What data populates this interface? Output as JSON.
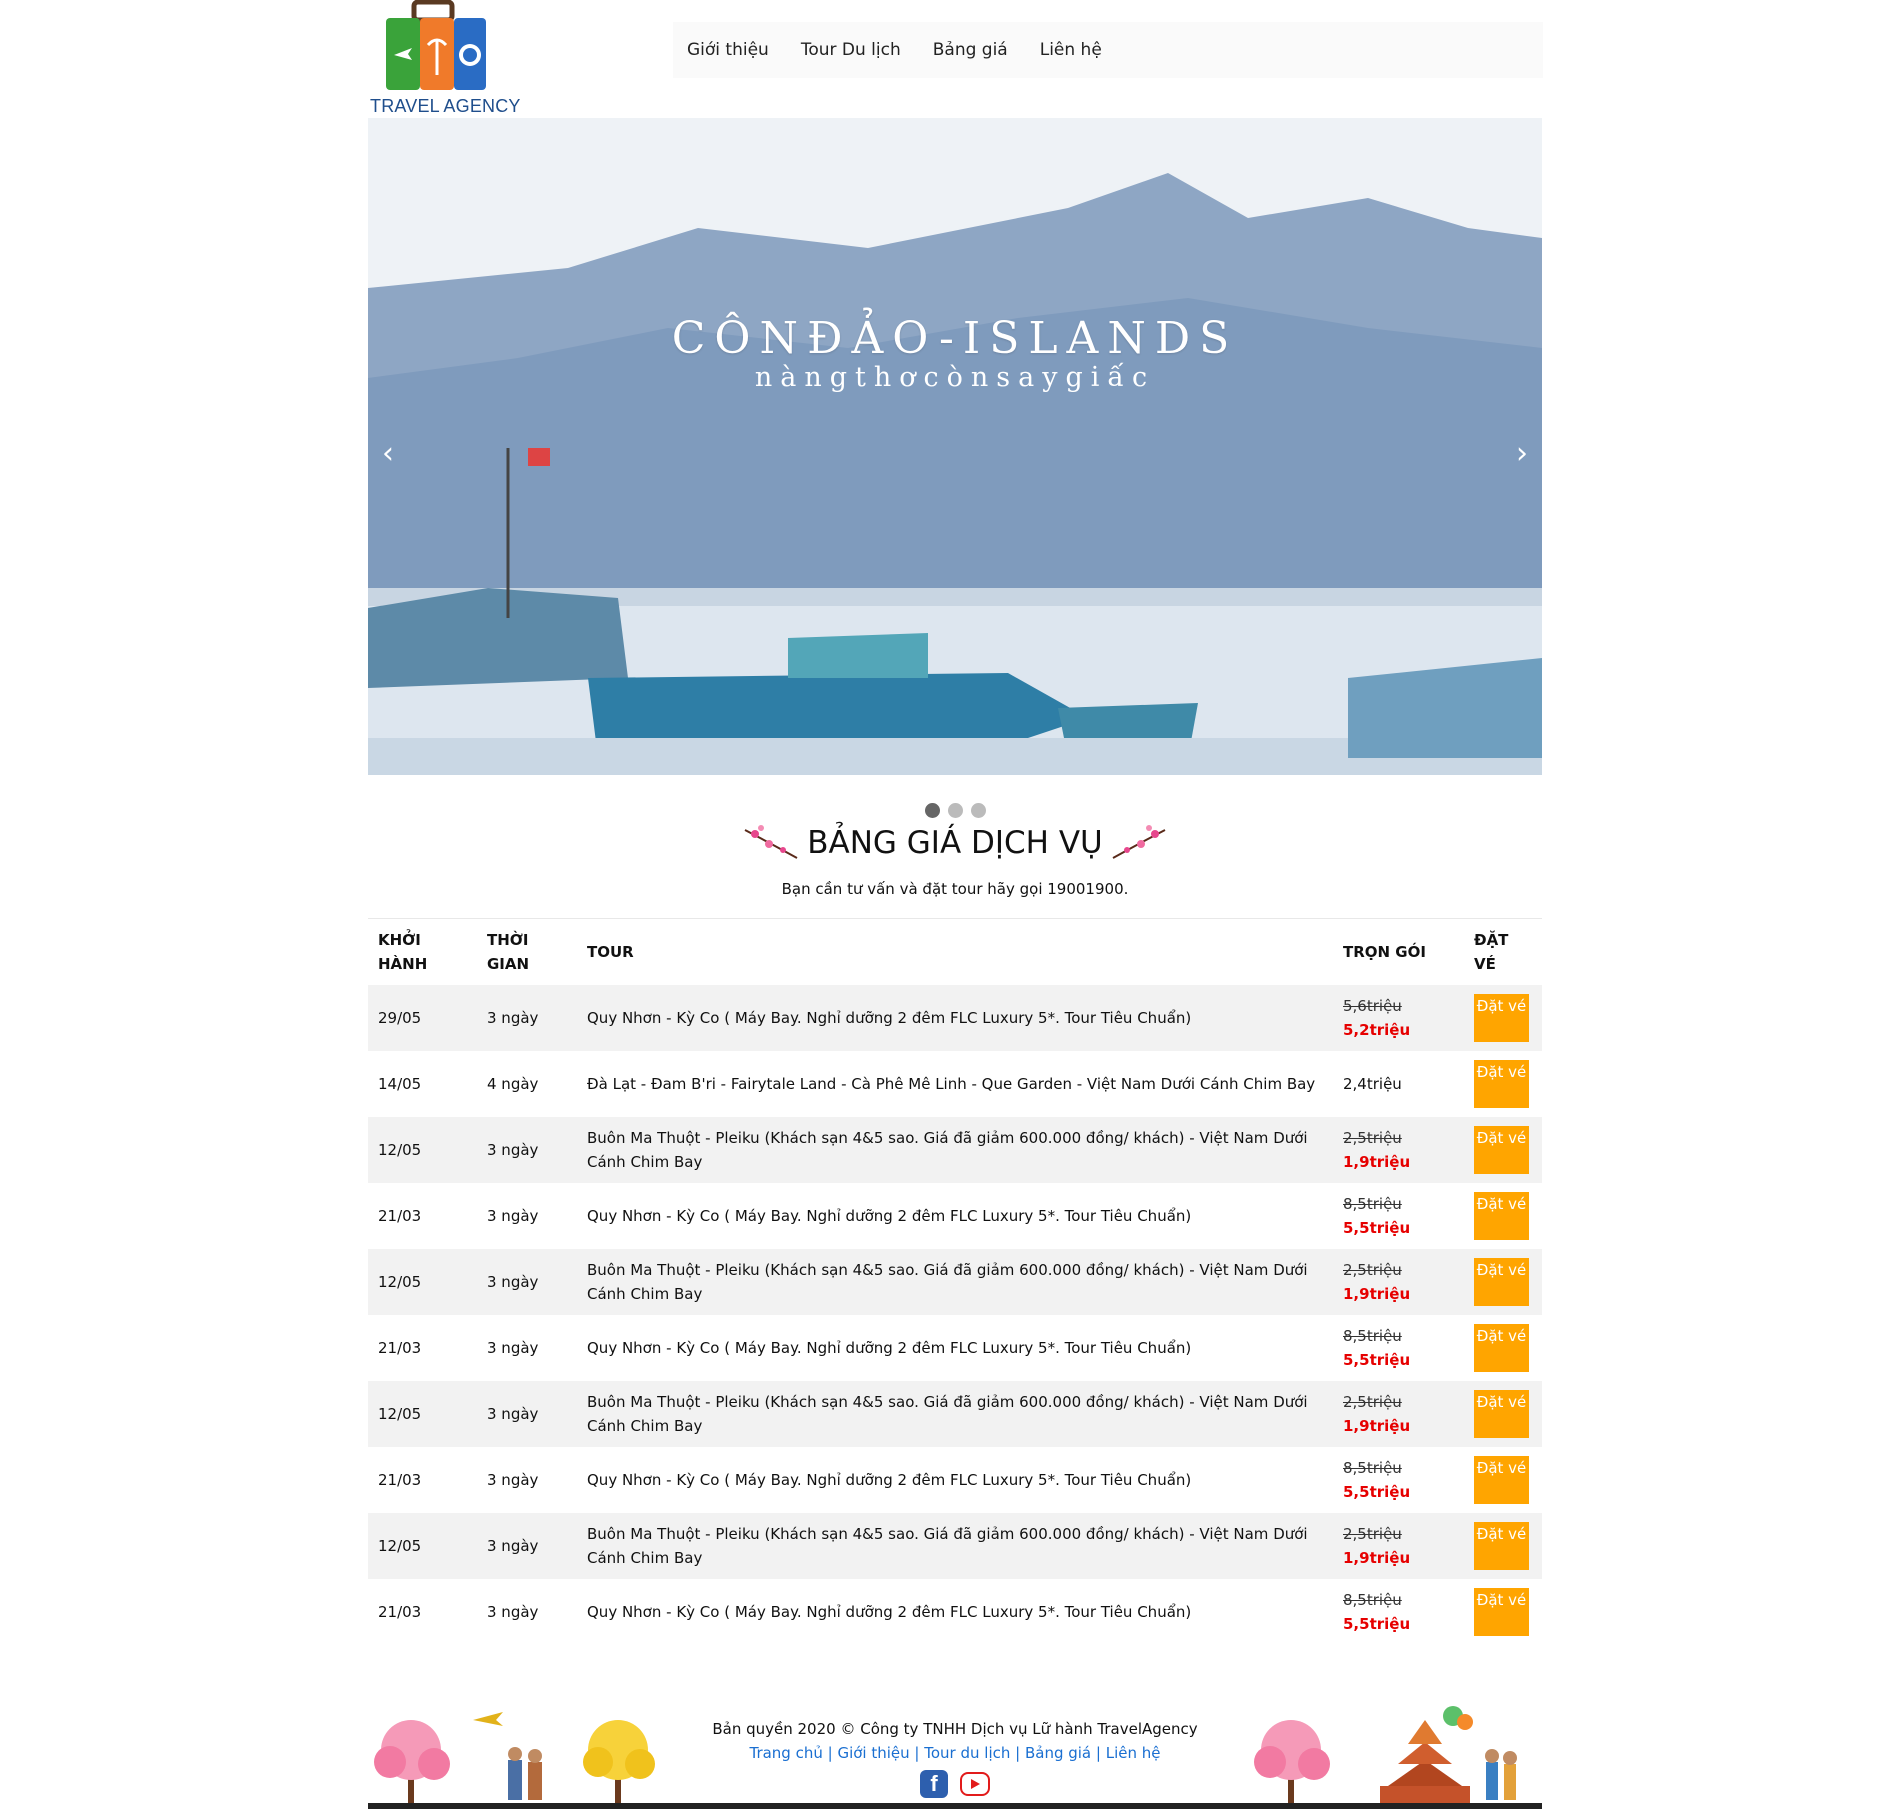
{
  "logo": {
    "text": "TRAVEL AGENCY"
  },
  "nav": [
    {
      "label": "Giới thiệu"
    },
    {
      "label": "Tour Du lịch"
    },
    {
      "label": "Bảng giá"
    },
    {
      "label": "Liên hệ"
    }
  ],
  "slider": {
    "title": "CÔNĐẢO-ISLANDS",
    "subtitle": "nàngthơcònsaygiấc",
    "prev": "‹",
    "next": "›",
    "slides": 3,
    "active": 1
  },
  "section": {
    "title": "BẢNG GIÁ DỊCH VỤ",
    "subtitle": "Bạn cần tư vấn và đặt tour hãy gọi 19001900."
  },
  "table": {
    "headers": [
      "KHỞI HÀNH",
      "THỜI GIAN",
      "TOUR",
      "TRỌN GÓI",
      "ĐẶT VÉ"
    ],
    "book_label": "Đặt vé",
    "rows": [
      {
        "date": "29/05",
        "duration": "3 ngày",
        "tour": "Quy Nhơn - Kỳ Co ( Máy Bay. Nghỉ dưỡng 2 đêm FLC Luxury 5*. Tour Tiêu Chuẩn)",
        "old_price": "5,6triệu",
        "new_price": "5,2triệu"
      },
      {
        "date": "14/05",
        "duration": "4 ngày",
        "tour": "Đà Lạt - Đam B'ri - Fairytale Land - Cà Phê Mê Linh - Que Garden - Việt Nam Dưới Cánh Chim Bay",
        "old_price": "",
        "new_price": "",
        "price": "2,4triệu"
      },
      {
        "date": "12/05",
        "duration": "3 ngày",
        "tour": "Buôn Ma Thuột - Pleiku (Khách sạn 4&5 sao. Giá đã giảm 600.000 đồng/ khách) - Việt Nam Dưới Cánh Chim Bay",
        "old_price": "2,5triệu",
        "new_price": "1,9triệu"
      },
      {
        "date": "21/03",
        "duration": "3 ngày",
        "tour": "Quy Nhơn - Kỳ Co ( Máy Bay. Nghỉ dưỡng 2 đêm FLC Luxury 5*. Tour Tiêu Chuẩn)",
        "old_price": "8,5triệu",
        "new_price": "5,5triệu"
      },
      {
        "date": "12/05",
        "duration": "3 ngày",
        "tour": "Buôn Ma Thuột - Pleiku (Khách sạn 4&5 sao. Giá đã giảm 600.000 đồng/ khách) - Việt Nam Dưới Cánh Chim Bay",
        "old_price": "2,5triệu",
        "new_price": "1,9triệu"
      },
      {
        "date": "21/03",
        "duration": "3 ngày",
        "tour": "Quy Nhơn - Kỳ Co ( Máy Bay. Nghỉ dưỡng 2 đêm FLC Luxury 5*. Tour Tiêu Chuẩn)",
        "old_price": "8,5triệu",
        "new_price": "5,5triệu"
      },
      {
        "date": "12/05",
        "duration": "3 ngày",
        "tour": "Buôn Ma Thuột - Pleiku (Khách sạn 4&5 sao. Giá đã giảm 600.000 đồng/ khách) - Việt Nam Dưới Cánh Chim Bay",
        "old_price": "2,5triệu",
        "new_price": "1,9triệu"
      },
      {
        "date": "21/03",
        "duration": "3 ngày",
        "tour": "Quy Nhơn - Kỳ Co ( Máy Bay. Nghỉ dưỡng 2 đêm FLC Luxury 5*. Tour Tiêu Chuẩn)",
        "old_price": "8,5triệu",
        "new_price": "5,5triệu"
      },
      {
        "date": "12/05",
        "duration": "3 ngày",
        "tour": "Buôn Ma Thuột - Pleiku (Khách sạn 4&5 sao. Giá đã giảm 600.000 đồng/ khách) - Việt Nam Dưới Cánh Chim Bay",
        "old_price": "2,5triệu",
        "new_price": "1,9triệu"
      },
      {
        "date": "21/03",
        "duration": "3 ngày",
        "tour": "Quy Nhơn - Kỳ Co ( Máy Bay. Nghỉ dưỡng 2 đêm FLC Luxury 5*. Tour Tiêu Chuẩn)",
        "old_price": "8,5triệu",
        "new_price": "5,5triệu"
      }
    ]
  },
  "footer": {
    "copyright": "Bản quyền 2020 © Công ty TNHH Dịch vụ Lữ hành TravelAgency",
    "links": [
      "Trang chủ",
      "Giới thiệu",
      "Tour du lịch",
      "Bảng giá",
      "Liên hệ"
    ],
    "separator": " | "
  },
  "colors": {
    "accent": "#ffa500",
    "sale": "#e60000",
    "link": "#1a6fd1"
  }
}
